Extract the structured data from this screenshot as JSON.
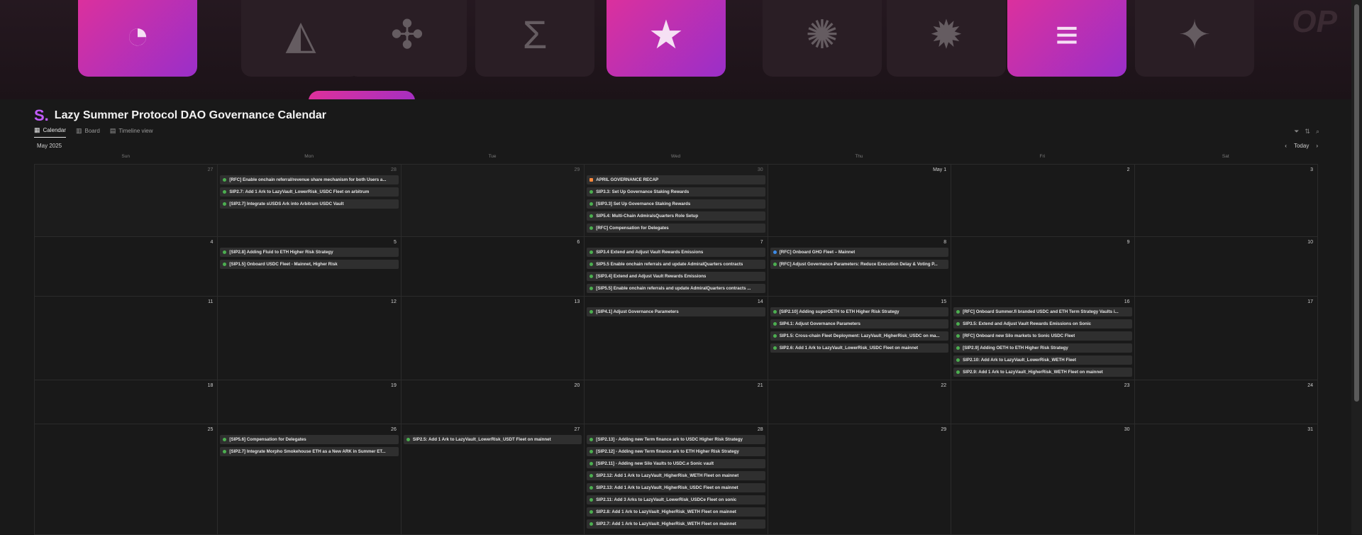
{
  "banner": {
    "tiles": [
      {
        "icon": "pie-icon",
        "glyph": "◔",
        "accent": true
      },
      {
        "icon": "arbitrum-icon",
        "glyph": "◭",
        "accent": false
      },
      {
        "icon": "butterfly-icon",
        "glyph": "✣",
        "accent": false
      },
      {
        "icon": "sigma-icon",
        "glyph": "Σ",
        "accent": false
      },
      {
        "icon": "star-icon",
        "glyph": "★",
        "accent": true
      },
      {
        "icon": "pinwheel-icon",
        "glyph": "✺",
        "accent": false
      },
      {
        "icon": "flame-gear-icon",
        "glyph": "✹",
        "accent": false
      },
      {
        "icon": "stripes-icon",
        "glyph": "≡",
        "accent": true
      },
      {
        "icon": "star-outline-icon",
        "glyph": "✦",
        "accent": false
      }
    ],
    "corner_text": "OP"
  },
  "header": {
    "logo": "S.",
    "title": "Lazy Summer Protocol DAO Governance Calendar"
  },
  "tabs": [
    {
      "label": "Calendar",
      "icon": "calendar-icon",
      "glyph": "▦",
      "active": true
    },
    {
      "label": "Board",
      "icon": "board-icon",
      "glyph": "▥",
      "active": false
    },
    {
      "label": "Timeline view",
      "icon": "timeline-icon",
      "glyph": "▤",
      "active": false
    }
  ],
  "tools": [
    {
      "icon": "filter-icon",
      "glyph": "⏷"
    },
    {
      "icon": "sort-icon",
      "glyph": "⇅"
    },
    {
      "icon": "search-icon",
      "glyph": "⌕"
    }
  ],
  "calendar": {
    "month_label": "May 2025",
    "today_label": "Today",
    "prev_glyph": "‹",
    "next_glyph": "›",
    "weekdays": [
      "Sun",
      "Mon",
      "Tue",
      "Wed",
      "Thu",
      "Fri",
      "Sat"
    ],
    "colors": {
      "green": "#4caf50",
      "blue": "#3d8be8",
      "orange": "#ff8a3d"
    },
    "weeks": [
      [
        {
          "day": "27",
          "dim": true,
          "events": []
        },
        {
          "day": "28",
          "dim": true,
          "events": [
            {
              "text": "[RFC] Enable onchain referral/revenue share mechanism for both Users a...",
              "status": "green"
            },
            {
              "text": "SIP2.7: Add 1 Ark to LazyVault_LowerRisk_USDC Fleet on arbitrum",
              "status": "green"
            },
            {
              "text": "[SIP2.7] Integrate sUSDS Ark into Arbitrum USDC Vault",
              "status": "green"
            }
          ]
        },
        {
          "day": "29",
          "dim": true,
          "events": []
        },
        {
          "day": "30",
          "dim": true,
          "events": [
            {
              "text": "APRIL GOVERNANCE RECAP",
              "status": "orange"
            },
            {
              "text": "SIP3.3: Set Up Governance Staking Rewards",
              "status": "green"
            },
            {
              "text": "[SIP3.3] Set Up Governance Staking Rewards",
              "status": "green"
            },
            {
              "text": "SIP5.4: Multi-Chain AdmiralsQuarters Role Setup",
              "status": "green"
            },
            {
              "text": "[RFC] Compensation for Delegates",
              "status": "green"
            }
          ]
        },
        {
          "day": "May 1",
          "dim": false,
          "events": []
        },
        {
          "day": "2",
          "dim": false,
          "events": []
        },
        {
          "day": "3",
          "dim": false,
          "events": []
        }
      ],
      [
        {
          "day": "4",
          "dim": false,
          "events": []
        },
        {
          "day": "5",
          "dim": false,
          "events": [
            {
              "text": "[SIP2.8] Adding Fluid to ETH Higher Risk Strategy",
              "status": "green"
            },
            {
              "text": "[SIP1.5] Onboard USDC Fleet - Mainnet, Higher Risk",
              "status": "green"
            }
          ]
        },
        {
          "day": "6",
          "dim": false,
          "events": []
        },
        {
          "day": "7",
          "dim": false,
          "events": [
            {
              "text": "SIP3.4 Extend and Adjust Vault Rewards Emissions",
              "status": "green"
            },
            {
              "text": "SIP5.5 Enable onchain referrals and update AdmiralQuarters contracts",
              "status": "green"
            },
            {
              "text": "[SIP3.4] Extend and Adjust Vault Rewards Emissions",
              "status": "green"
            },
            {
              "text": "[SIP5.5] Enable onchain referrals and update AdmiralQuarters contracts ...",
              "status": "green"
            }
          ]
        },
        {
          "day": "8",
          "dim": false,
          "events": [
            {
              "text": "[RFC] Onboard GHO Fleet – Mainnet",
              "status": "blue"
            },
            {
              "text": "[RFC] Adjust Governance Parameters: Reduce Execution Delay & Voting P...",
              "status": "green"
            }
          ]
        },
        {
          "day": "9",
          "dim": false,
          "events": []
        },
        {
          "day": "10",
          "dim": false,
          "events": []
        }
      ],
      [
        {
          "day": "11",
          "dim": false,
          "events": []
        },
        {
          "day": "12",
          "dim": false,
          "events": []
        },
        {
          "day": "13",
          "dim": false,
          "events": []
        },
        {
          "day": "14",
          "dim": false,
          "events": [
            {
              "text": "[SIP4.1] Adjust Governance Parameters",
              "status": "green"
            }
          ]
        },
        {
          "day": "15",
          "dim": false,
          "events": [
            {
              "text": "[SIP2.10] Adding superOETH to ETH Higher Risk Strategy",
              "status": "green"
            },
            {
              "text": "SIP4.1: Adjust Governance Parameters",
              "status": "green"
            },
            {
              "text": "SIP1.5: Cross-chain Fleet Deployment: LazyVault_HigherRisk_USDC on ma...",
              "status": "green"
            },
            {
              "text": "SIP2.6: Add 1 Ark to LazyVault_LowerRisk_USDC Fleet on mainnet",
              "status": "green"
            }
          ]
        },
        {
          "day": "16",
          "dim": false,
          "events": [
            {
              "text": "[RFC] Onboard Summer.fi branded USDC and ETH Term Strategy Vaults i...",
              "status": "green"
            },
            {
              "text": "SIP3.5: Extend and Adjust Vault Rewards Emissions on Sonic",
              "status": "green"
            },
            {
              "text": "[RFC] Onboard new Silo markets to Sonic USDC Fleet",
              "status": "green"
            },
            {
              "text": "[SIP2.9] Adding OETH to ETH Higher Risk Strategy",
              "status": "green"
            },
            {
              "text": "SIP2.10: Add Ark to LazyVault_LowerRisk_WETH Fleet",
              "status": "green"
            },
            {
              "text": "SIP2.9: Add 1 Ark to LazyVault_HigherRisk_WETH Fleet on mainnet",
              "status": "green"
            }
          ]
        },
        {
          "day": "17",
          "dim": false,
          "events": []
        }
      ],
      [
        {
          "day": "18",
          "dim": false,
          "events": []
        },
        {
          "day": "19",
          "dim": false,
          "events": []
        },
        {
          "day": "20",
          "dim": false,
          "events": []
        },
        {
          "day": "21",
          "dim": false,
          "events": []
        },
        {
          "day": "22",
          "dim": false,
          "events": []
        },
        {
          "day": "23",
          "dim": false,
          "events": []
        },
        {
          "day": "24",
          "dim": false,
          "events": []
        }
      ],
      [
        {
          "day": "25",
          "dim": false,
          "events": []
        },
        {
          "day": "26",
          "dim": false,
          "events": [
            {
              "text": "[SIP5.6] Compensation for Delegates",
              "status": "green"
            },
            {
              "text": "[SIP2.7] Integrate Morpho Smokehouse ETH as a New ARK in Summer ET...",
              "status": "green"
            }
          ]
        },
        {
          "day": "27",
          "dim": false,
          "events": [
            {
              "text": "SIP2.5: Add 1 Ark to LazyVault_LowerRisk_USDT Fleet on mainnet",
              "status": "green"
            }
          ]
        },
        {
          "day": "28",
          "dim": false,
          "events": [
            {
              "text": "[SIP2.13] - Adding new Term finance ark to USDC Higher Risk Strategy",
              "status": "green"
            },
            {
              "text": "[SIP2.12] - Adding new Term finance ark to ETH Higher Risk Strategy",
              "status": "green"
            },
            {
              "text": "[SIP2.11] - Adding new Silo Vaults to USDC.e Sonic vault",
              "status": "green"
            },
            {
              "text": "SIP2.12: Add 1 Ark to LazyVault_HigherRisk_WETH Fleet on mainnet",
              "status": "green"
            },
            {
              "text": "SIP2.13: Add 1 Ark to LazyVault_HigherRisk_USDC Fleet on mainnet",
              "status": "green"
            },
            {
              "text": "SIP2.11: Add 3 Arks to LazyVault_LowerRisk_USDCe Fleet on sonic",
              "status": "green"
            },
            {
              "text": "SIP2.8: Add 1 Ark to LazyVault_HigherRisk_WETH Fleet on mainnet",
              "status": "green"
            },
            {
              "text": "SIP2.7: Add 1 Ark to LazyVault_HigherRisk_WETH Fleet on mainnet",
              "status": "green"
            }
          ]
        },
        {
          "day": "29",
          "dim": false,
          "events": []
        },
        {
          "day": "30",
          "dim": false,
          "events": []
        },
        {
          "day": "31",
          "dim": false,
          "events": []
        }
      ]
    ]
  }
}
